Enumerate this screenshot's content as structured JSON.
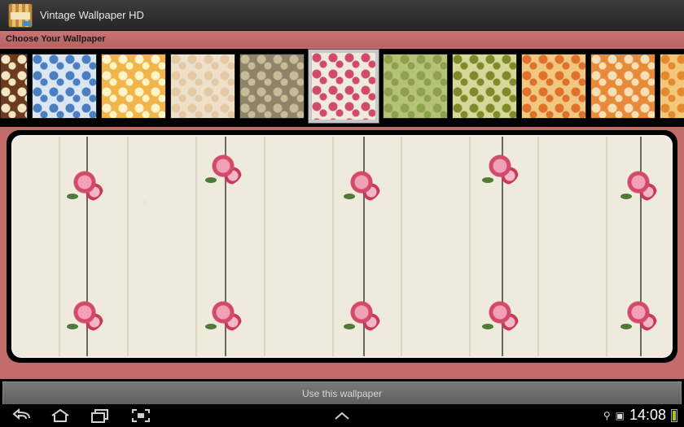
{
  "app": {
    "title": "Vintage Wallpaper HD",
    "icon": "app-icon"
  },
  "panel": {
    "subtitle": "Choose Your Wallpaper"
  },
  "thumbnails": [
    {
      "name": "brown-flowers",
      "color": "#6b3b1c",
      "accent": "#f3e6c5",
      "selected": false
    },
    {
      "name": "blue-floral",
      "color": "#dbe6f0",
      "accent": "#4a7fc1",
      "selected": false
    },
    {
      "name": "yellow-daisies",
      "color": "#f1b54a",
      "accent": "#fff3c8",
      "selected": false
    },
    {
      "name": "cream-damask",
      "color": "#efe0c9",
      "accent": "#e3c9a4",
      "selected": false
    },
    {
      "name": "brown-lace",
      "color": "#8f836a",
      "accent": "#c8bb98",
      "selected": false
    },
    {
      "name": "rose-stripe",
      "color": "#efebdc",
      "accent": "#d24a6b",
      "selected": true
    },
    {
      "name": "green-damask",
      "color": "#b6c277",
      "accent": "#8ea24d",
      "selected": false
    },
    {
      "name": "green-lattice",
      "color": "#d8d79a",
      "accent": "#7e8a2b",
      "selected": false
    },
    {
      "name": "orange-dots",
      "color": "#f0c87f",
      "accent": "#e0702a",
      "selected": false
    },
    {
      "name": "orange-flowers",
      "color": "#e88a3a",
      "accent": "#f7e0b3",
      "selected": false
    },
    {
      "name": "orange-dots-2",
      "color": "#f3c77a",
      "accent": "#e38a30",
      "selected": false
    }
  ],
  "action": {
    "use_label": "Use this wallpaper"
  },
  "navbar": {
    "back": "back-icon",
    "home": "home-icon",
    "recents": "recent-apps-icon",
    "screenshot": "screenshot-icon",
    "up": "chevron-up-icon",
    "time": "14:08"
  },
  "colors": {
    "panel": "#c26b6b",
    "actionbar": "#2e2e2e",
    "button": "#6a6a6a"
  }
}
